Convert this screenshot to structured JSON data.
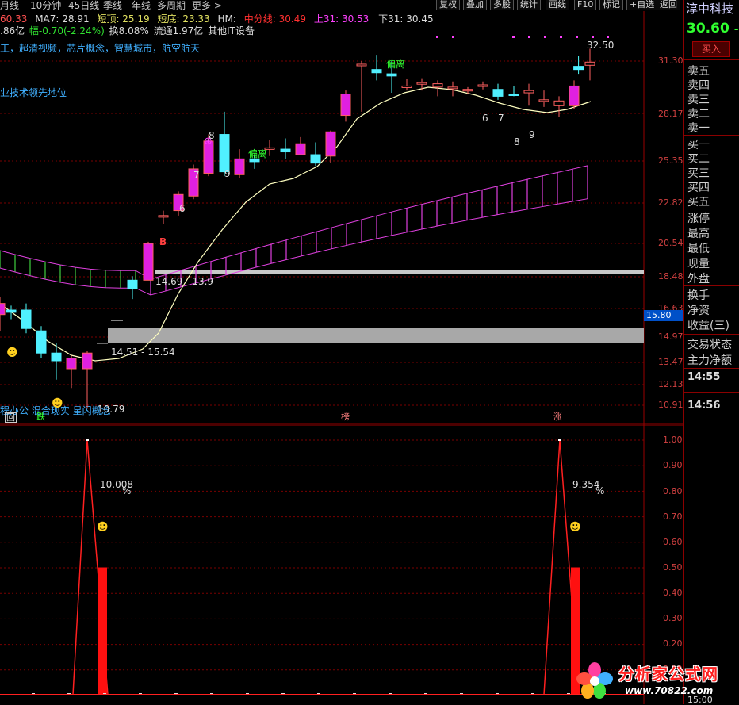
{
  "toolbar": {
    "periods": [
      "月线",
      "10分钟",
      "45日线",
      "季线",
      "年线",
      "多周期",
      "更多 >"
    ],
    "buttons": [
      "复权",
      "叠加",
      "多股",
      "统计",
      "画线",
      "F10",
      "标记",
      "+自选",
      "返回"
    ]
  },
  "info_line1": {
    "ma_prefix": "60.33",
    "ma7": "MA7: 28.91",
    "short_top": "短顶: 25.19",
    "short_bottom": "短底: 23.33",
    "hm": "HM:",
    "mid_line": "中分线: 30.49",
    "upper": "上31: 30.53",
    "lower": "下31: 30.45"
  },
  "info_line2": {
    "amount": ".86亿",
    "change": "幅-0.70(-2.24%)",
    "turnover": "换8.08%",
    "float": "流通1.97亿",
    "industry": "其他IT设备"
  },
  "concepts": "工，超清视频，芯片概念，智慧城市，航空航天",
  "tech_note": "业技术领先地位",
  "bottom_concepts": "程办公 混合现实 星闪概念",
  "annotations": {
    "deviation1": "偏离",
    "deviation2": "偏离",
    "peak_price": "32.50",
    "band_upper": "14.69 - 13.9",
    "band_lower": "14.51 - 15.54",
    "low_price": "10.79",
    "counts": [
      "6",
      "7",
      "8",
      "9",
      "6",
      "7",
      "8",
      "9"
    ],
    "b_mark": "B",
    "markers": [
      "回",
      "跌",
      "榜",
      "涨"
    ],
    "pct1": "10.008",
    "pct2": "9.354",
    "pct_unit": "%"
  },
  "price_axis": [
    "31.30",
    "28.17",
    "25.35",
    "22.82",
    "20.54",
    "18.48",
    "16.63",
    "14.97",
    "13.47",
    "12.13",
    "10.91"
  ],
  "current_price_tag": "15.80",
  "indicator_axis": [
    "1.00",
    "0.90",
    "0.80",
    "0.70",
    "0.60",
    "0.50",
    "0.40",
    "0.30",
    "0.20",
    "0.10"
  ],
  "right_panel": {
    "stock_name": "淳中科技",
    "price": "30.60",
    "price_suffix": "-0",
    "buy_button": "买入",
    "order_book": [
      "卖五",
      "卖四",
      "卖三",
      "卖二",
      "卖一",
      "买一",
      "买二",
      "买三",
      "买四",
      "买五"
    ],
    "stats": [
      "涨停",
      "最高",
      "最低",
      "现量",
      "外盘",
      "换手",
      "净资",
      "收益(三)",
      "交易状态",
      "主力净额"
    ],
    "times": [
      "14:55",
      "14:56",
      "15:00"
    ]
  },
  "watermark": {
    "text": "分析家公式网",
    "url": "www.70822.com"
  },
  "chart_data": {
    "type": "candlestick",
    "ylim": [
      10.5,
      33.5
    ],
    "candles": [
      {
        "o": 14.4,
        "h": 15.2,
        "l": 13.7,
        "c": 14.9
      },
      {
        "o": 14.6,
        "h": 14.8,
        "l": 14.2,
        "c": 14.5
      },
      {
        "o": 14.6,
        "h": 14.9,
        "l": 13.6,
        "c": 13.8
      },
      {
        "o": 13.7,
        "h": 13.9,
        "l": 12.6,
        "c": 12.8
      },
      {
        "o": 12.8,
        "h": 13.2,
        "l": 11.8,
        "c": 12.5
      },
      {
        "o": 12.2,
        "h": 12.7,
        "l": 11.5,
        "c": 12.6
      },
      {
        "o": 12.2,
        "h": 12.9,
        "l": 10.8,
        "c": 12.8
      },
      {
        "o": 16.0,
        "h": 16.2,
        "l": 15.1,
        "c": 15.6
      },
      {
        "o": 16.0,
        "h": 18.0,
        "l": 16.0,
        "c": 17.9
      },
      {
        "o": 19.5,
        "h": 19.8,
        "l": 19.0,
        "c": 19.5
      },
      {
        "o": 19.8,
        "h": 21.0,
        "l": 19.5,
        "c": 20.8
      },
      {
        "o": 20.7,
        "h": 22.8,
        "l": 20.5,
        "c": 22.5
      },
      {
        "o": 22.2,
        "h": 25.0,
        "l": 22.0,
        "c": 24.5
      },
      {
        "o": 25.0,
        "h": 26.8,
        "l": 22.0,
        "c": 22.3
      },
      {
        "o": 22.1,
        "h": 23.9,
        "l": 21.9,
        "c": 23.2
      },
      {
        "o": 23.2,
        "h": 23.5,
        "l": 22.5,
        "c": 23.0
      },
      {
        "o": 24.0,
        "h": 24.6,
        "l": 23.4,
        "c": 24.0
      },
      {
        "o": 23.9,
        "h": 24.7,
        "l": 23.2,
        "c": 23.7
      },
      {
        "o": 23.5,
        "h": 24.8,
        "l": 23.5,
        "c": 24.3
      },
      {
        "o": 23.5,
        "h": 24.4,
        "l": 22.7,
        "c": 22.9
      },
      {
        "o": 23.4,
        "h": 25.3,
        "l": 22.9,
        "c": 25.2
      },
      {
        "o": 26.5,
        "h": 28.6,
        "l": 26.0,
        "c": 28.3
      },
      {
        "o": 30.9,
        "h": 31.3,
        "l": 26.8,
        "c": 31.0
      },
      {
        "o": 30.5,
        "h": 31.9,
        "l": 29.5,
        "c": 30.2
      },
      {
        "o": 30.1,
        "h": 31.3,
        "l": 28.4,
        "c": 29.9
      },
      {
        "o": 29.0,
        "h": 29.6,
        "l": 28.6,
        "c": 29.0
      },
      {
        "o": 29.3,
        "h": 29.7,
        "l": 28.6,
        "c": 29.3
      },
      {
        "o": 28.9,
        "h": 29.5,
        "l": 28.1,
        "c": 29.2
      },
      {
        "o": 28.9,
        "h": 29.4,
        "l": 28.1,
        "c": 28.9
      },
      {
        "o": 28.7,
        "h": 28.9,
        "l": 28.3,
        "c": 28.7
      },
      {
        "o": 29.0,
        "h": 29.4,
        "l": 28.7,
        "c": 29.1
      },
      {
        "o": 28.7,
        "h": 29.2,
        "l": 27.8,
        "c": 28.1
      },
      {
        "o": 28.3,
        "h": 29.0,
        "l": 28.1,
        "c": 28.2
      },
      {
        "o": 28.4,
        "h": 29.2,
        "l": 27.3,
        "c": 28.6
      },
      {
        "o": 27.8,
        "h": 28.6,
        "l": 27.2,
        "c": 27.8
      },
      {
        "o": 27.3,
        "h": 28.1,
        "l": 26.4,
        "c": 27.7
      },
      {
        "o": 27.3,
        "h": 29.5,
        "l": 27.0,
        "c": 29.0
      },
      {
        "o": 30.9,
        "h": 32.5,
        "l": 29.5,
        "c": 31.2
      },
      {
        "o": 30.8,
        "h": 31.8,
        "l": 30.1,
        "c": 30.5
      }
    ],
    "indicator": {
      "pct_marks": [
        {
          "index": 6,
          "value": 1.0
        },
        {
          "index": 37,
          "value": 1.0
        }
      ],
      "bars": [
        {
          "index": 7,
          "value": 0.5
        },
        {
          "index": 38,
          "value": 0.5
        }
      ]
    }
  }
}
